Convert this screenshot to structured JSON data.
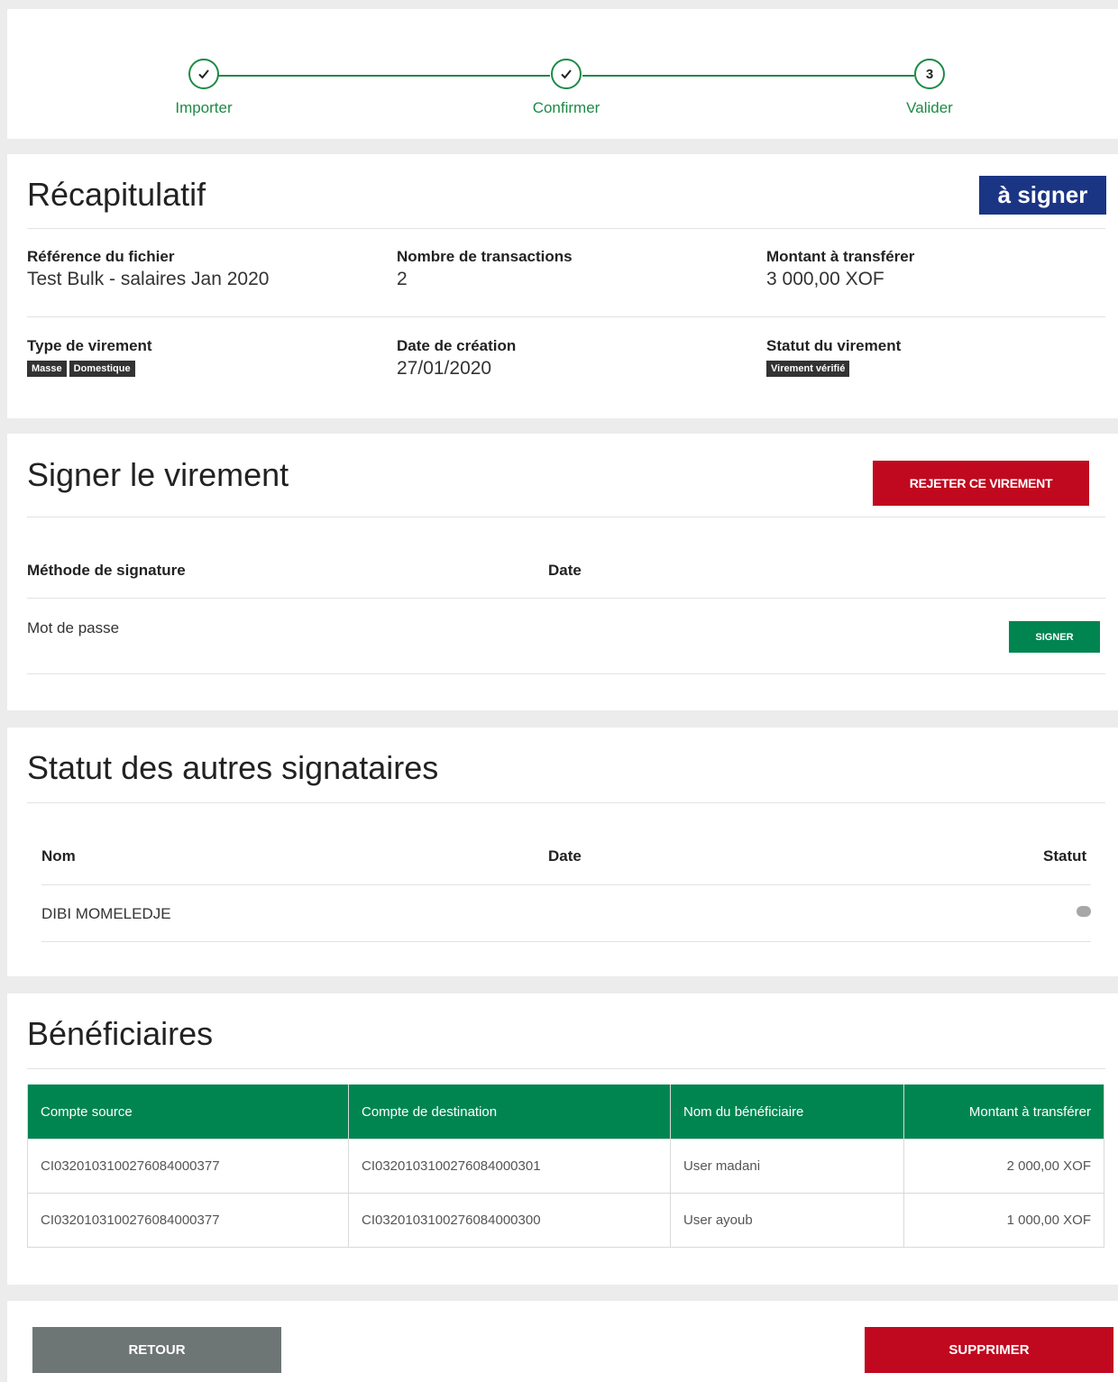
{
  "stepper": {
    "steps": [
      {
        "label": "Importer",
        "marker": "✓"
      },
      {
        "label": "Confirmer",
        "marker": "✓"
      },
      {
        "label": "Valider",
        "marker": "3"
      }
    ],
    "color": "#1d8a46"
  },
  "recap": {
    "title": "Récapitulatif",
    "status_badge": "à signer",
    "fields": {
      "file_ref": {
        "label": "Référence du fichier",
        "value": "Test Bulk - salaires Jan 2020"
      },
      "tx_count": {
        "label": "Nombre de transactions",
        "value": "2"
      },
      "amount": {
        "label": "Montant à transférer",
        "value": "3 000,00 XOF"
      },
      "transfer_type": {
        "label": "Type de virement",
        "tags": [
          "Masse",
          "Domestique"
        ]
      },
      "created": {
        "label": "Date de création",
        "value": "27/01/2020"
      },
      "transfer_status": {
        "label": "Statut du virement",
        "tags": [
          "Virement vérifié"
        ]
      }
    }
  },
  "sign": {
    "title": "Signer le virement",
    "reject_label": "REJETER CE VIREMENT",
    "col_method": "Méthode de signature",
    "col_date": "Date",
    "method": "Mot de passe",
    "sign_label": "SIGNER"
  },
  "others": {
    "title": "Statut des autres signataires",
    "col_name": "Nom",
    "col_date": "Date",
    "col_status": "Statut",
    "rows": [
      {
        "name": "DIBI MOMELEDJE",
        "date": "",
        "status_icon": "grey-status-dot"
      }
    ]
  },
  "beneficiaries": {
    "title": "Bénéficiaires",
    "columns": [
      "Compte source",
      "Compte de destination",
      "Nom du bénéficiaire",
      "Montant à transférer"
    ],
    "rows": [
      [
        "CI0320103100276084000377",
        "CI0320103100276084000301",
        "User madani",
        "2 000,00 XOF"
      ],
      [
        "CI0320103100276084000377",
        "CI0320103100276084000300",
        "User ayoub",
        "1 000,00 XOF"
      ]
    ]
  },
  "footer": {
    "back_label": "RETOUR",
    "delete_label": "SUPPRIMER"
  },
  "colors": {
    "green": "#008551",
    "red": "#c0091f",
    "navy": "#1b3585",
    "grey_button": "#6e7575"
  }
}
